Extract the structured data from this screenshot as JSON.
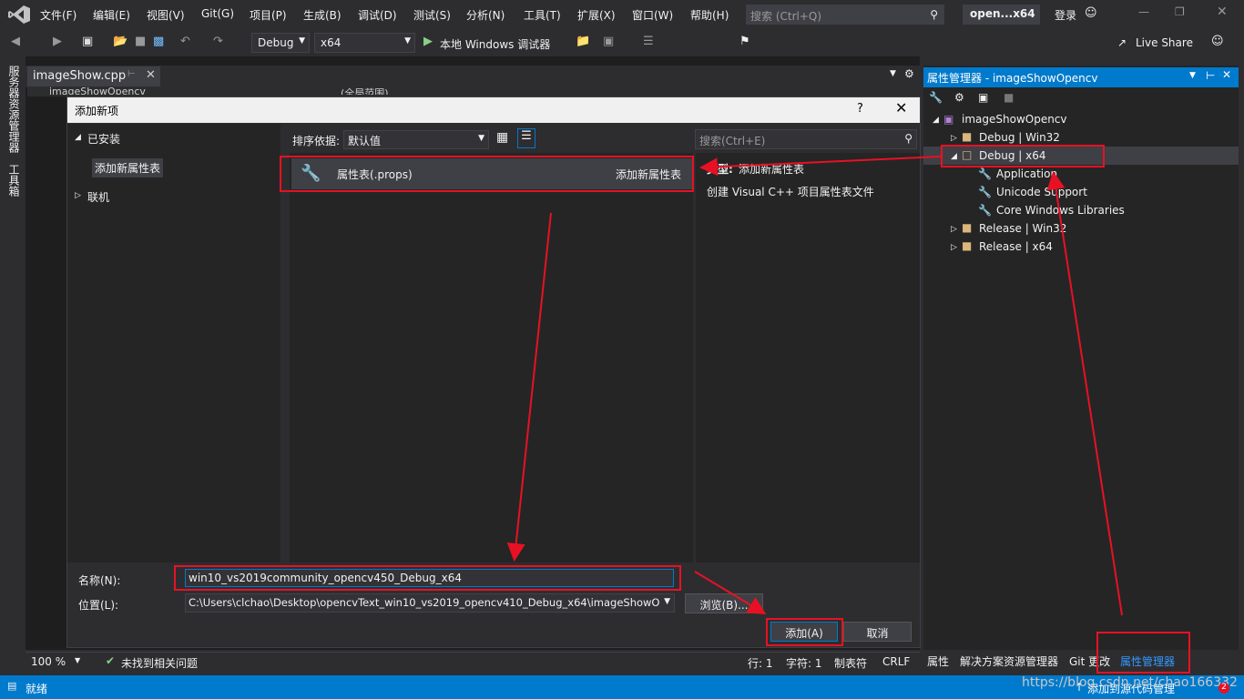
{
  "menu": [
    "文件(F)",
    "编辑(E)",
    "视图(V)",
    "Git(G)",
    "项目(P)",
    "生成(B)",
    "调试(D)",
    "测试(S)",
    "分析(N)",
    "工具(T)",
    "扩展(X)",
    "窗口(W)",
    "帮助(H)"
  ],
  "search": {
    "placeholder": "搜索 (Ctrl+Q)"
  },
  "title_pill": "open...x64",
  "login": "登录",
  "toolbar": {
    "config": "Debug",
    "platform": "x64",
    "run": "本地 Windows 调试器",
    "live_share": "Live Share"
  },
  "leftstrip": {
    "a": "服务器资源管理器",
    "b": "工具箱"
  },
  "editor": {
    "tab": "imageShow.cpp",
    "nav_left": "imageShowOpencv",
    "nav_mid": "(全局范围)"
  },
  "dialog": {
    "title": "添加新项",
    "help": "?",
    "installed": "已安装",
    "category": "添加新属性表",
    "online": "联机",
    "sort_label": "排序依据:",
    "sort_value": "默认值",
    "search_placeholder": "搜索(Ctrl+E)",
    "item_name": "属性表(.props)",
    "item_category": "添加新属性表",
    "type_label": "类型:",
    "type_value": "添加新属性表",
    "description": "创建 Visual C++ 项目属性表文件",
    "name_label": "名称(N):",
    "name_value": "win10_vs2019community_opencv450_Debug_x64",
    "location_label": "位置(L):",
    "location_value": "C:\\Users\\clchao\\Desktop\\opencvText_win10_vs2019_opencv410_Debug_x64\\imageShowO",
    "browse": "浏览(B)...",
    "add": "添加(A)",
    "cancel": "取消"
  },
  "editor_status": {
    "zoom": "100 %",
    "issues": "未找到相关问题",
    "line": "行: 1",
    "char": "字符: 1",
    "tab": "制表符",
    "eol": "CRLF"
  },
  "status": {
    "ready": "就绪",
    "source_control": "添加到源代码管理",
    "watermark": "https://blog.csdn.net/chao166332",
    "badge": "2"
  },
  "property_manager": {
    "title": "属性管理器 - imageShowOpencv",
    "project": "imageShowOpencv",
    "nodes": [
      "Debug | Win32",
      "Debug | x64",
      "Application",
      "Unicode Support",
      "Core Windows Libraries",
      "Release | Win32",
      "Release | x64"
    ]
  },
  "bottom_tabs": [
    "属性",
    "解决方案资源管理器",
    "Git 更改",
    "属性管理器"
  ],
  "colors": {
    "accent": "#007acc",
    "annotation": "#e81123"
  }
}
